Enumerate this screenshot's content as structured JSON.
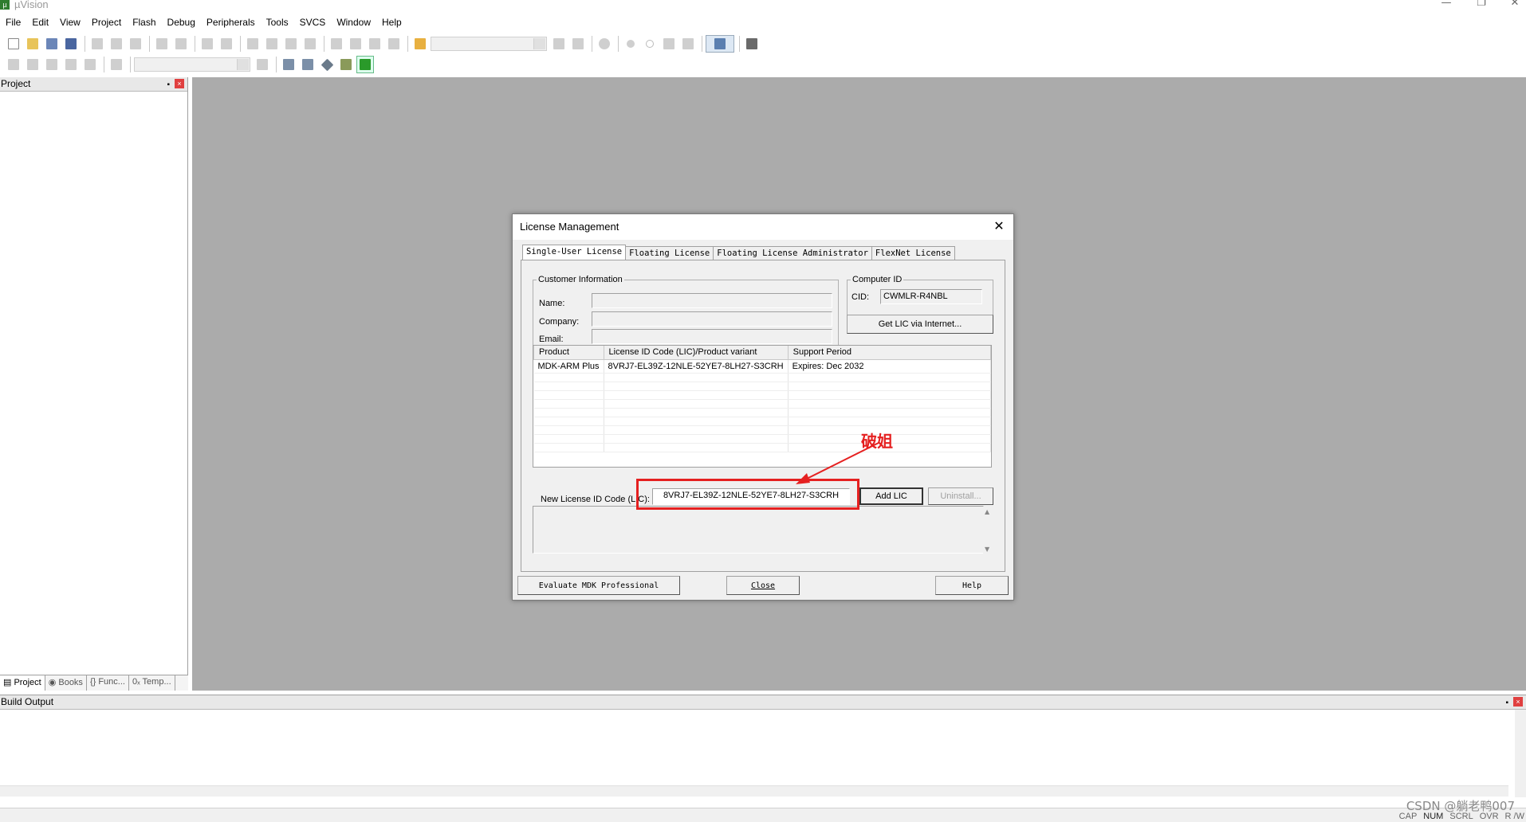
{
  "app": {
    "title": "µVision",
    "icon": "uvision-logo-icon",
    "window_controls": {
      "minimize": "—",
      "restore": "❐",
      "close": "✕"
    }
  },
  "menu": [
    "File",
    "Edit",
    "View",
    "Project",
    "Flash",
    "Debug",
    "Peripherals",
    "Tools",
    "SVCS",
    "Window",
    "Help"
  ],
  "project_pane": {
    "title": "Project",
    "pin": "📌",
    "close": "×",
    "tabs": [
      {
        "label": "Project"
      },
      {
        "label": "Books"
      },
      {
        "label": "{} Func..."
      },
      {
        "label": "0ₓ Temp..."
      }
    ]
  },
  "build_output": {
    "title": "Build Output",
    "pin": "📌",
    "close": "×"
  },
  "dialog": {
    "title": "License Management",
    "close": "✕",
    "tabs": [
      "Single-User License",
      "Floating License",
      "Floating License Administrator",
      "FlexNet License"
    ],
    "customer_info": {
      "legend": "Customer Information",
      "name_label": "Name:",
      "company_label": "Company:",
      "email_label": "Email:",
      "name": "",
      "company": "",
      "email": ""
    },
    "computer_id": {
      "legend": "Computer ID",
      "cid_label": "CID:",
      "cid": "CWMLR-R4NBL"
    },
    "get_lic_button": "Get LIC via Internet...",
    "table": {
      "headers": [
        "Product",
        "License ID Code (LIC)/Product variant",
        "Support Period"
      ],
      "rows": [
        [
          "MDK-ARM Plus",
          "8VRJ7-EL39Z-12NLE-52YE7-8LH27-S3CRH",
          "Expires: Dec 2032"
        ]
      ]
    },
    "new_lic_label": "New License ID Code (LIC):",
    "new_lic_value": "8VRJ7-EL39Z-12NLE-52YE7-8LH27-S3CRH",
    "add_lic_button": "Add LIC",
    "uninstall_button": "Uninstall...",
    "evaluate_button": "Evaluate MDK Professional",
    "close_button": "Close",
    "help_button": "Help"
  },
  "annotation": {
    "text": "破姐",
    "color": "#e52020"
  },
  "status_bar": {
    "indicators": [
      "CAP",
      "NUM",
      "SCRL",
      "OVR",
      "R /W"
    ],
    "watermark": "CSDN @躺老鸭007"
  },
  "colors": {
    "workspace_bg": "#ababab",
    "dialog_bg": "#f0f0f0",
    "highlight": "#e52020"
  }
}
